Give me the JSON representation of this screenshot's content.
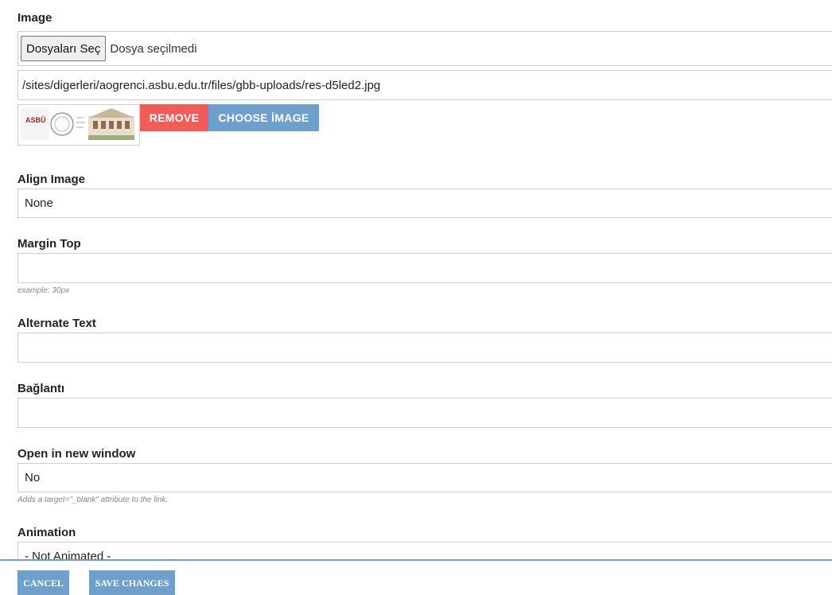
{
  "image": {
    "label": "Image",
    "file_button_label": "Dosyaları Seç",
    "file_status": "Dosya seçilmedi",
    "path_value": "/sites/digerleri/aogrenci.asbu.edu.tr/files/gbb-uploads/res-d5led2.jpg",
    "thumb_logo_text": "ASBÜ",
    "remove_label": "REMOVE",
    "choose_label": "CHOOSE İMAGE"
  },
  "align_image": {
    "label": "Align Image",
    "value": "None"
  },
  "margin_top": {
    "label": "Margin Top",
    "value": "",
    "help": "example: 30px"
  },
  "alternate_text": {
    "label": "Alternate Text",
    "value": ""
  },
  "link": {
    "label": "Bağlantı",
    "value": ""
  },
  "open_new_window": {
    "label": "Open in new window",
    "value": "No",
    "help": "Adds a target=\"_blank\" attribute to the link."
  },
  "animation": {
    "label": "Animation",
    "value": "- Not Animated -"
  },
  "footer": {
    "cancel_label": "CANCEL",
    "save_label": "SAVE CHANGES"
  },
  "colors": {
    "remove_button": "#f05d59",
    "primary_button": "#6f9fcb"
  }
}
